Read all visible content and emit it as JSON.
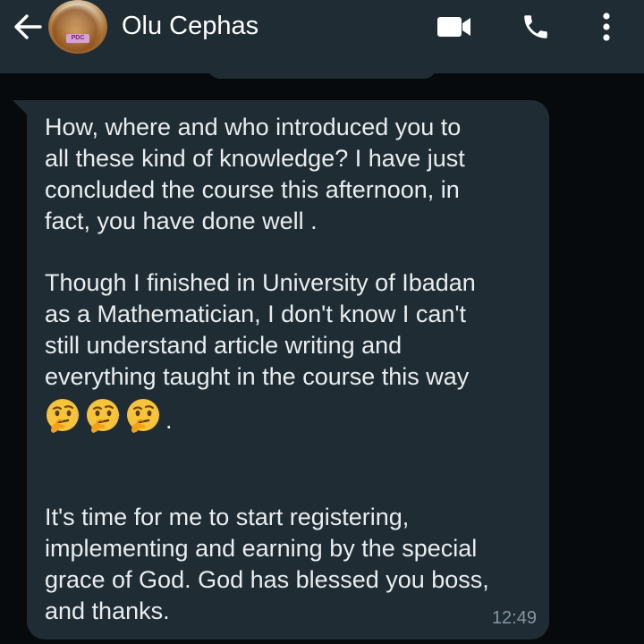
{
  "header": {
    "contact_name": "Olu Cephas",
    "back_icon": "arrow-left-icon",
    "video_icon": "video-camera-icon",
    "call_icon": "phone-icon",
    "menu_icon": "more-vertical-icon",
    "avatar_badge": "PDC",
    "background": "#1f2c34"
  },
  "message": {
    "paragraphs": [
      "How, where and who introduced you to\nall these kind of knowledge? I have just\nconcluded the course this afternoon, in\nfact, you have done well .",
      "Though I finished in University of Ibadan\nas a Mathematician, I don't know I can't\nstill understand article writing and\neverything taught in the course this way",
      "It's time for me to start registering,\nimplementing and earning by the special\ngrace of God. God has blessed you boss,\nand thanks."
    ],
    "emoji_icons": [
      "thinking-face-icon",
      "thinking-face-icon",
      "thinking-face-icon"
    ],
    "emoji_suffix": ".",
    "time": "12:49",
    "bubble_color": "#1f2c34"
  },
  "colors": {
    "background": "#060a0c",
    "text": "#e9edef",
    "timestamp": "#8696a0"
  }
}
